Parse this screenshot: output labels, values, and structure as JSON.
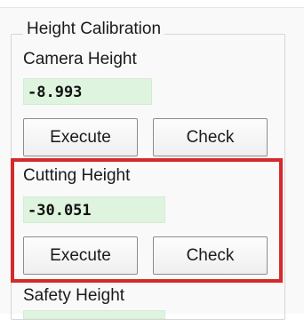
{
  "group": {
    "title": "Height Calibration"
  },
  "camera_height": {
    "label": "Camera Height",
    "value": "-8.993",
    "execute_label": "Execute",
    "check_label": "Check"
  },
  "cutting_height": {
    "label": "Cutting Height",
    "value": "-30.051",
    "execute_label": "Execute",
    "check_label": "Check"
  },
  "safety_height": {
    "label": "Safety Height"
  },
  "highlight_color": "#d42a2a",
  "value_field_color": "#dff4df"
}
